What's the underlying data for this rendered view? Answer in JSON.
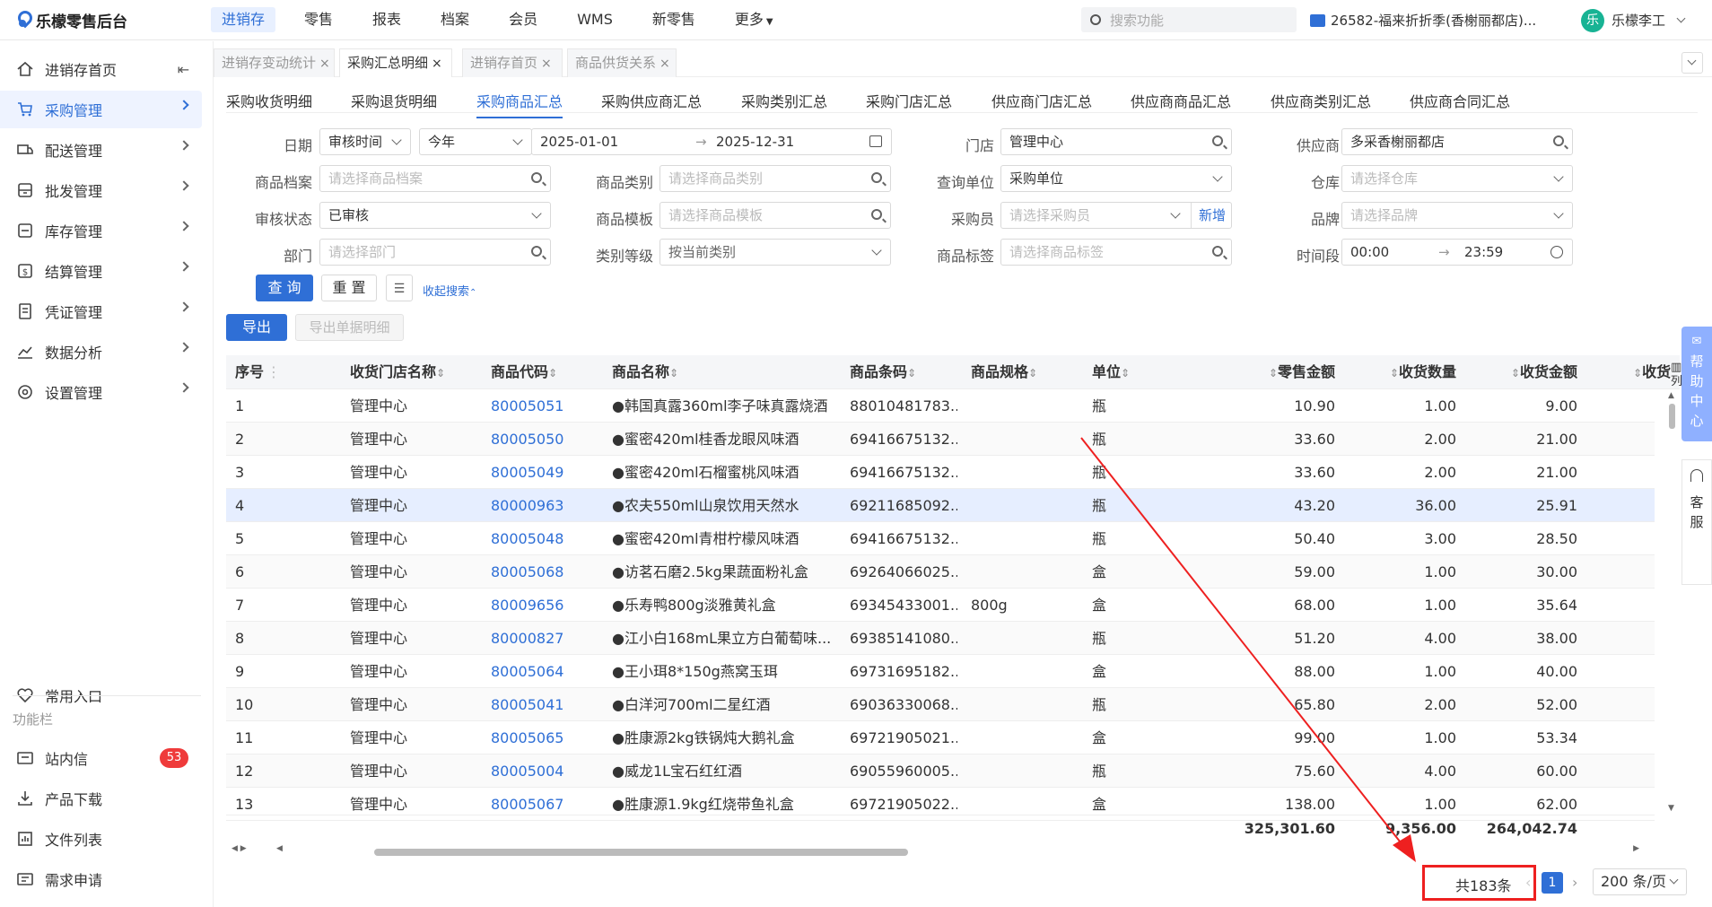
{
  "app": {
    "title": "乐檬零售后台"
  },
  "topnav": [
    "进销存",
    "零售",
    "报表",
    "档案",
    "会员",
    "WMS",
    "新零售",
    "更多"
  ],
  "topsearch_placeholder": "搜索功能",
  "store": "26582-福来折折季(香榭丽都店)...",
  "user": {
    "avatar": "乐",
    "name": "乐檬李工"
  },
  "sidebar": {
    "items": [
      "进销存首页",
      "采购管理",
      "配送管理",
      "批发管理",
      "库存管理",
      "结算管理",
      "凭证管理",
      "数据分析",
      "设置管理"
    ],
    "common": "常用入口",
    "section": "功能栏",
    "tools": [
      "站内信",
      "产品下载",
      "文件列表",
      "需求申请"
    ],
    "badge": "53"
  },
  "tabs": [
    "进销存变动统计",
    "采购汇总明细",
    "进销存首页",
    "商品供货关系"
  ],
  "subtabs": [
    "采购收货明细",
    "采购退货明细",
    "采购商品汇总",
    "采购供应商汇总",
    "采购类别汇总",
    "采购门店汇总",
    "供应商门店汇总",
    "供应商商品汇总",
    "供应商类别汇总",
    "供应商合同汇总"
  ],
  "filters": {
    "date_label": "日期",
    "date_type": "审核时间",
    "date_range": "今年",
    "date_start": "2025-01-01",
    "date_end": "2025-12-31",
    "store_label": "门店",
    "store_value": "管理中心",
    "supplier_label": "供应商",
    "supplier_value": "多采香榭丽都店",
    "item_label": "商品档案",
    "item_ph": "请选择商品档案",
    "category_label": "商品类别",
    "category_ph": "请选择商品类别",
    "query_unit_label": "查询单位",
    "query_unit_value": "采购单位",
    "warehouse_label": "仓库",
    "warehouse_ph": "请选择仓库",
    "status_label": "审核状态",
    "status_value": "已审核",
    "template_label": "商品模板",
    "template_ph": "请选择商品模板",
    "buyer_label": "采购员",
    "buyer_ph": "请选择采购员",
    "buyer_add": "新增",
    "brand_label": "品牌",
    "brand_ph": "请选择品牌",
    "dept_label": "部门",
    "dept_ph": "请选择部门",
    "level_label": "类别等级",
    "level_value": "按当前类别",
    "tag_label": "商品标签",
    "tag_ph": "请选择商品标签",
    "time_label": "时间段",
    "time_start": "00:00",
    "time_end": "23:59"
  },
  "actions": {
    "query": "查 询",
    "reset": "重 置",
    "collapse": "收起搜索",
    "export": "导出",
    "export_detail": "导出单据明细"
  },
  "table": {
    "headers": [
      "序号",
      "收货门店名称",
      "商品代码",
      "商品名称",
      "商品条码",
      "商品规格",
      "单位",
      "零售金额",
      "收货数量",
      "收货金额",
      "收货"
    ],
    "rows": [
      [
        "1",
        "管理中心",
        "80005051",
        "●韩国真露360ml李子味真露烧酒",
        "88010481783...",
        "",
        "瓶",
        "10.90",
        "1.00",
        "9.00"
      ],
      [
        "2",
        "管理中心",
        "80005050",
        "●蜜密420ml桂香龙眼风味酒",
        "69416675132...",
        "",
        "瓶",
        "33.60",
        "2.00",
        "21.00"
      ],
      [
        "3",
        "管理中心",
        "80005049",
        "●蜜密420ml石榴蜜桃风味酒",
        "69416675132...",
        "",
        "瓶",
        "33.60",
        "2.00",
        "21.00"
      ],
      [
        "4",
        "管理中心",
        "80000963",
        "●农夫550ml山泉饮用天然水",
        "69211685092...",
        "",
        "瓶",
        "43.20",
        "36.00",
        "25.91"
      ],
      [
        "5",
        "管理中心",
        "80005048",
        "●蜜密420ml青柑柠檬风味酒",
        "69416675132...",
        "",
        "瓶",
        "50.40",
        "3.00",
        "28.50"
      ],
      [
        "6",
        "管理中心",
        "80005068",
        "●访茗石磨2.5kg果蔬面粉礼盒",
        "69264066025...",
        "",
        "盒",
        "59.00",
        "1.00",
        "30.00"
      ],
      [
        "7",
        "管理中心",
        "80009656",
        "●乐寿鸭800g淡雅黄礼盒",
        "69345433001...",
        "800g",
        "盒",
        "68.00",
        "1.00",
        "35.64"
      ],
      [
        "8",
        "管理中心",
        "80000827",
        "●江小白168mL果立方白葡萄味...",
        "69385141080...",
        "",
        "瓶",
        "51.20",
        "4.00",
        "38.00"
      ],
      [
        "9",
        "管理中心",
        "80005064",
        "●王小珥8*150g燕窝玉珥",
        "69731695182...",
        "",
        "盒",
        "88.00",
        "1.00",
        "40.00"
      ],
      [
        "10",
        "管理中心",
        "80005041",
        "●白洋河700ml二星红酒",
        "69036330068...",
        "",
        "瓶",
        "65.80",
        "2.00",
        "52.00"
      ],
      [
        "11",
        "管理中心",
        "80005065",
        "●胜康源2kg铁锅炖大鹅礼盒",
        "69721905021...",
        "",
        "盒",
        "99.00",
        "1.00",
        "53.34"
      ],
      [
        "12",
        "管理中心",
        "80005004",
        "●威龙1L宝石红红酒",
        "69055960005...",
        "",
        "瓶",
        "75.60",
        "4.00",
        "60.00"
      ],
      [
        "13",
        "管理中心",
        "80005067",
        "●胜康源1.9kg红烧带鱼礼盒",
        "69721905022...",
        "",
        "盒",
        "138.00",
        "1.00",
        "62.00"
      ]
    ],
    "totals": {
      "retail": "325,301.60",
      "qty": "9,356.00",
      "amount": "264,042.74"
    }
  },
  "pagination": {
    "total": "共183条",
    "page": "1",
    "size": "200 条/页"
  },
  "side_widgets": {
    "help": "帮助中心",
    "service": "客服",
    "columns": "列"
  }
}
